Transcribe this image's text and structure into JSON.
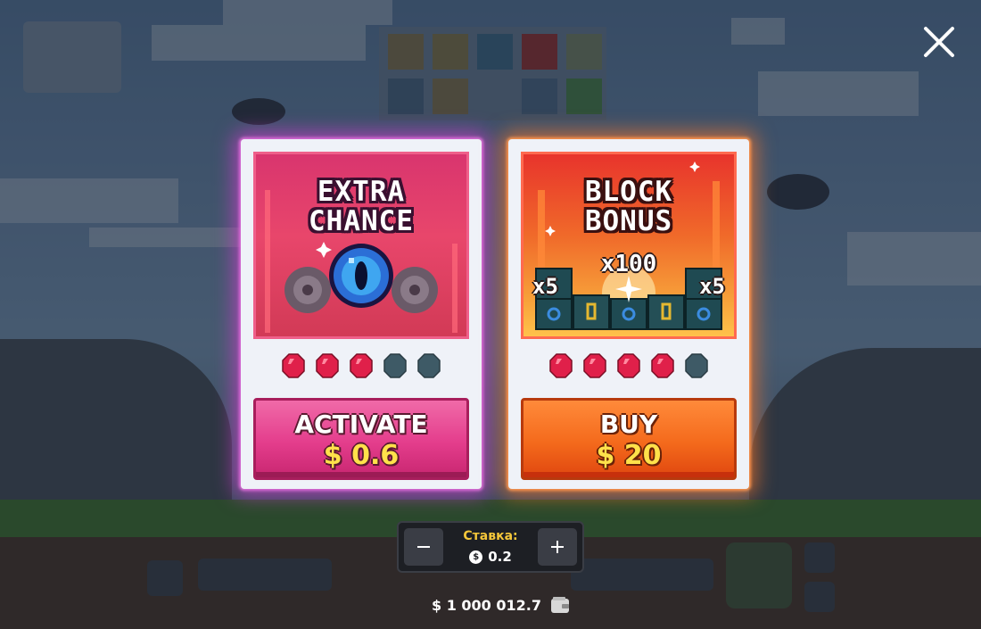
{
  "close_icon": "close-icon",
  "cards": [
    {
      "id": "extra-chance",
      "title": "EXTRA\nCHANCE",
      "gems_filled": 3,
      "gems_total": 5,
      "button_label": "ACTIVATE",
      "price": "$ 0.6",
      "accent": "#e43d8c"
    },
    {
      "id": "block-bonus",
      "title": "BLOCK\nBONUS",
      "gems_filled": 4,
      "gems_total": 5,
      "multipliers": {
        "center": "x100",
        "left": "x5",
        "right": "x5"
      },
      "button_label": "BUY",
      "price": "$ 20",
      "accent": "#f46a1c"
    }
  ],
  "bet": {
    "label": "Ставка:",
    "currency_icon": "$",
    "value": "0.2",
    "minus_icon": "minus-icon",
    "plus_icon": "plus-icon"
  },
  "balance": {
    "value": "$ 1 000 012.7",
    "icon": "wallet-icon"
  },
  "colors": {
    "gem_active": "#e0204a",
    "gem_inactive": "#3e5a66",
    "bet_label": "#f5c73a",
    "price": "#ffe14a"
  }
}
